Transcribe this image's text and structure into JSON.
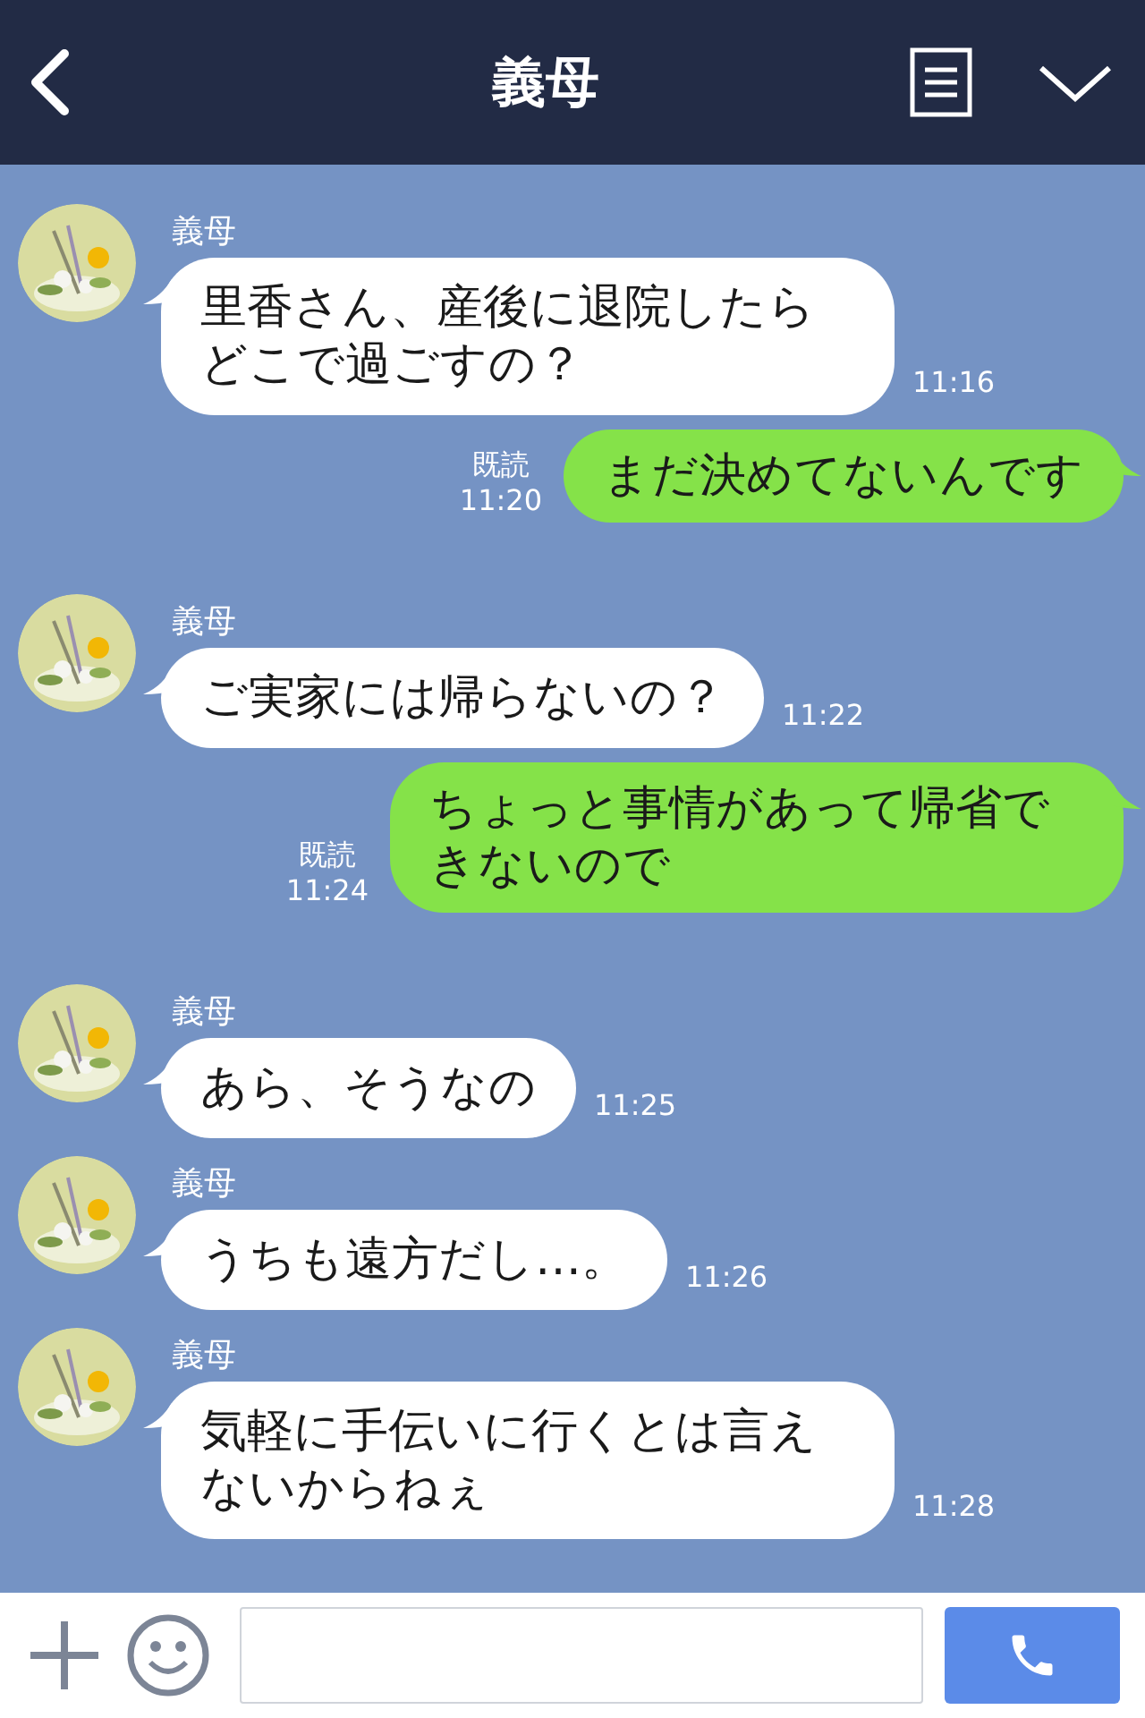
{
  "header": {
    "title": "義母"
  },
  "messages": [
    {
      "kind": "incoming",
      "sender": "義母",
      "text": "里香さん、産後に退院したらどこで過ごすの？",
      "time": "11:16"
    },
    {
      "kind": "outgoing",
      "read": "既読",
      "time": "11:20",
      "text": "まだ決めてないんです"
    },
    {
      "kind": "incoming",
      "sender": "義母",
      "text": "ご実家には帰らないの？",
      "time": "11:22"
    },
    {
      "kind": "outgoing",
      "read": "既読",
      "time": "11:24",
      "text": "ちょっと事情があって帰省できないので"
    },
    {
      "kind": "incoming",
      "sender": "義母",
      "text": "あら、そうなの",
      "time": "11:25"
    },
    {
      "kind": "incoming",
      "sender": "義母",
      "text": "うちも遠方だし…。",
      "time": "11:26"
    },
    {
      "kind": "incoming",
      "sender": "義母",
      "text": "気軽に手伝いに行くとは言えないからねぇ",
      "time": "11:28"
    }
  ]
}
